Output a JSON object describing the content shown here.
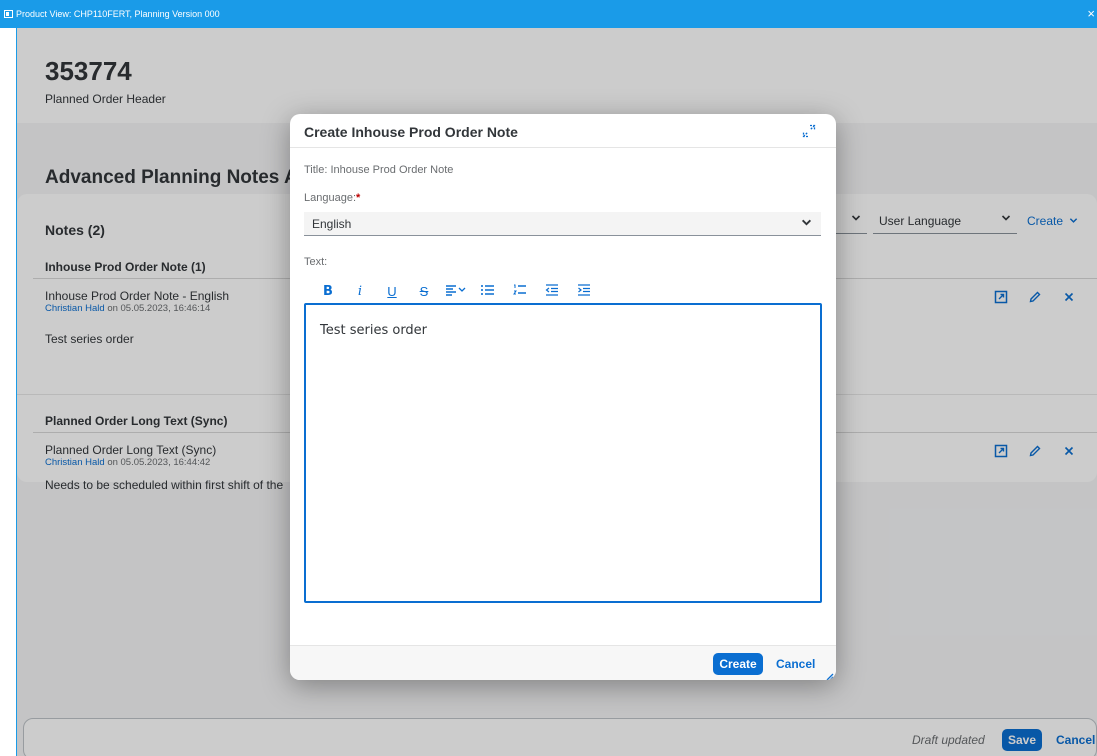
{
  "window": {
    "title": "Product View: CHP110FERT, Planning Version 000",
    "close": "×"
  },
  "header": {
    "order_number": "353774",
    "subtitle": "Planned Order Header"
  },
  "section": {
    "title": "Advanced Planning Notes Ass"
  },
  "notes": {
    "title": "Notes (2)",
    "filter_a_value": "",
    "filter_b_value": "User Language",
    "create_label": "Create",
    "groups": [
      {
        "title": "Inhouse Prod Order Note (1)",
        "note_title": "Inhouse Prod Order Note  - English",
        "author": "Christian Hald",
        "meta_suffix": "on 05.05.2023, 16:46:14",
        "body": "Test series order"
      },
      {
        "title": "Planned Order Long Text (Sync)",
        "note_title": "Planned Order Long Text (Sync)",
        "author": "Christian Hald",
        "meta_suffix": "on 05.05.2023, 16:44:42",
        "body": "Needs to be scheduled within first shift of the"
      }
    ]
  },
  "footer": {
    "status": "Draft updated",
    "save": "Save",
    "cancel": "Cancel"
  },
  "dialog": {
    "title": "Create Inhouse Prod Order Note",
    "title_field": "Title: Inhouse Prod Order Note",
    "language_label": "Language:",
    "language_required_marker": "*",
    "language_value": "English",
    "text_label": "Text:",
    "toolbar": {
      "bold": "B",
      "italic": "i",
      "underline": "U",
      "strike": "S"
    },
    "editor_text": "Test series order",
    "create": "Create",
    "cancel": "Cancel"
  },
  "colors": {
    "brand_blue": "#0a6ed1",
    "titlebar": "#1a9be8"
  },
  "icons": [
    "expand-icon",
    "chevron-down-icon",
    "edit-pencil-icon",
    "delete-x-icon",
    "open-note-icon",
    "align-icon",
    "bullet-list-icon",
    "numbered-list-icon",
    "outdent-icon",
    "indent-icon"
  ]
}
